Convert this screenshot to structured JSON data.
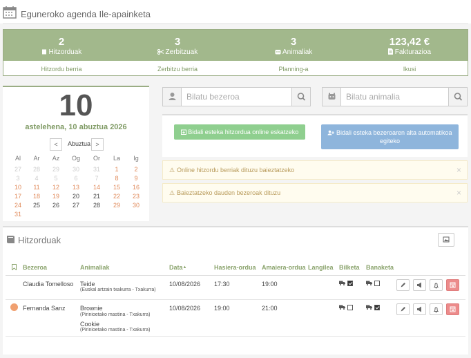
{
  "header": {
    "title": "Eguneroko agenda Ile-apainketa"
  },
  "stats": [
    {
      "value": "2",
      "label": "Hitzorduak",
      "icon": "book-icon",
      "link": "Hitzordu berria"
    },
    {
      "value": "3",
      "label": "Zerbitzuak",
      "icon": "scissors-icon",
      "link": "Zerbitzu berria"
    },
    {
      "value": "3",
      "label": "Animaliak",
      "icon": "paw-icon",
      "link": "Planning-a"
    },
    {
      "value": "123,42 €",
      "label": "Fakturazioa",
      "icon": "invoice-icon",
      "link": "Ikusi"
    }
  ],
  "date_panel": {
    "day": "10",
    "date_text": "astelehena, 10 abuztua 2026",
    "month": "Abuztua",
    "prev": "<",
    "next": ">",
    "weekdays": [
      "Al",
      "Ar",
      "Az",
      "Og",
      "Or",
      "La",
      "Ig"
    ],
    "weeks": [
      [
        "27",
        "28",
        "29",
        "30",
        "31",
        "1",
        "2"
      ],
      [
        "3",
        "4",
        "5",
        "6",
        "7",
        "8",
        "9"
      ],
      [
        "10",
        "11",
        "12",
        "13",
        "14",
        "15",
        "16"
      ],
      [
        "17",
        "18",
        "19",
        "20",
        "21",
        "22",
        "23"
      ],
      [
        "24",
        "25",
        "26",
        "27",
        "28",
        "29",
        "30"
      ],
      [
        "31",
        "",
        "",
        "",
        "",
        "",
        ""
      ]
    ]
  },
  "search": {
    "client_placeholder": "Bilatu bezeroa",
    "animal_placeholder": "Bilatu animalia"
  },
  "actions": {
    "online_link": "Bidali esteka hitzordua online eskatzeko",
    "client_link": "Bidali esteka bezeroaren alta automatikoa egiteko"
  },
  "alerts": [
    {
      "text": "Online hitzordu berriak dituzu baieztatzeko"
    },
    {
      "text": "Baieztatzeko dauden bezeroak dituzu"
    }
  ],
  "appointments": {
    "title": "Hitzorduak",
    "columns": [
      "Bezeroa",
      "Animaliak",
      "Data",
      "Hasiera-ordua",
      "Amaiera-ordua",
      "Langilea",
      "Bilketa",
      "Banaketa"
    ],
    "sort_indicator": "▲",
    "rows": [
      {
        "client": "Claudia Tomelloso",
        "marked": false,
        "animals": [
          {
            "name": "Teide",
            "breed": "(Euskal artzain txakurra - Txakurra)"
          }
        ],
        "date": "10/08/2026",
        "start": "17:30",
        "end": "19:00",
        "worker": "",
        "pickup": true,
        "delivery": false
      },
      {
        "client": "Fernanda Sanz",
        "marked": true,
        "animals": [
          {
            "name": "Brownie",
            "breed": "(Pirinioetako mastina - Txakurra)"
          },
          {
            "name": "Cookie",
            "breed": "(Pirinioetako mastina - Txakurra)"
          }
        ],
        "date": "10/08/2026",
        "start": "19:00",
        "end": "21:00",
        "worker": "",
        "pickup": false,
        "delivery": true
      }
    ]
  },
  "colors": {
    "accent": "#a2b88c",
    "weekend": "#e08a5a",
    "success_button": "#8fcf8f",
    "info_button": "#8eb5dc",
    "danger_button": "#ec8b8b",
    "client_dot": "#f0a070"
  }
}
